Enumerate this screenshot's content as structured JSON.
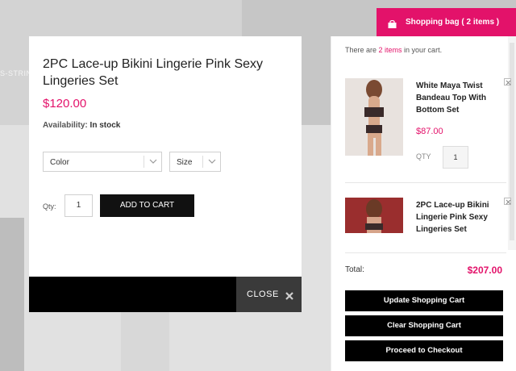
{
  "background": {
    "strip_text": "S-STRIN"
  },
  "quickview": {
    "title": "2PC Lace-up Bikini Lingerie Pink Sexy Lingeries Set",
    "price": "$120.00",
    "availability_label": "Availability:",
    "availability_value": "In stock",
    "color_select": "Color",
    "size_select": "Size",
    "qty_label": "Qty:",
    "qty_value": "1",
    "add_to_cart": "ADD TO CART",
    "close_label": "CLOSE"
  },
  "bag": {
    "label": "Shopping bag ( 2 items )"
  },
  "cart": {
    "info_prefix": "There are ",
    "info_count": "2 items",
    "info_suffix": " in your cart.",
    "items": [
      {
        "name": "White Maya Twist Bandeau Top With Bottom Set",
        "price": "$87.00",
        "qty_label": "QTY",
        "qty": "1"
      },
      {
        "name": "2PC Lace-up Bikini Lingerie Pink Sexy Lingeries Set"
      }
    ],
    "total_label": "Total:",
    "total_value": "$207.00",
    "update_button": "Update Shopping Cart",
    "clear_button": "Clear Shopping Cart",
    "checkout_button": "Proceed to Checkout"
  },
  "colors": {
    "accent": "#e3126a",
    "button_dark": "#000000"
  }
}
